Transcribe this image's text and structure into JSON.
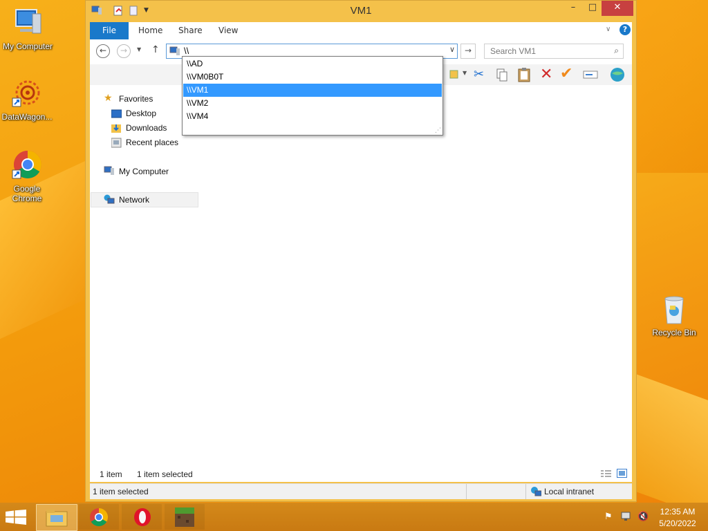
{
  "desktop": {
    "icons": [
      {
        "label": "My Computer"
      },
      {
        "label": "DataWagon..."
      },
      {
        "label": "Google Chrome"
      },
      {
        "label": "Recycle Bin"
      }
    ]
  },
  "window": {
    "title": "VM1",
    "controls": {
      "minimize": "–",
      "maximize": "□",
      "close": "✕"
    },
    "ribbon_tabs": [
      "File",
      "Home",
      "Share",
      "View"
    ],
    "address_value": "\\\\",
    "search_placeholder": "Search VM1",
    "nav": {
      "favorites": "Favorites",
      "desktop": "Desktop",
      "downloads": "Downloads",
      "recent": "Recent places",
      "my_computer": "My Computer",
      "network": "Network"
    },
    "status_inner": {
      "count": "1 item",
      "selected": "1 item selected"
    },
    "status_bar": {
      "left": "1 item selected",
      "right": "Local intranet"
    }
  },
  "dropdown": {
    "items": [
      "\\\\AD",
      "\\\\VM0B0T",
      "\\\\VM1",
      "\\\\VM2",
      "\\\\VM4"
    ],
    "selected_index": 2
  },
  "taskbar": {
    "time": "12:35 AM",
    "date": "5/20/2022"
  },
  "colors": {
    "accent": "#1979ca",
    "selection": "#3399ff",
    "close": "#c74040",
    "frame": "#f4c14a"
  }
}
